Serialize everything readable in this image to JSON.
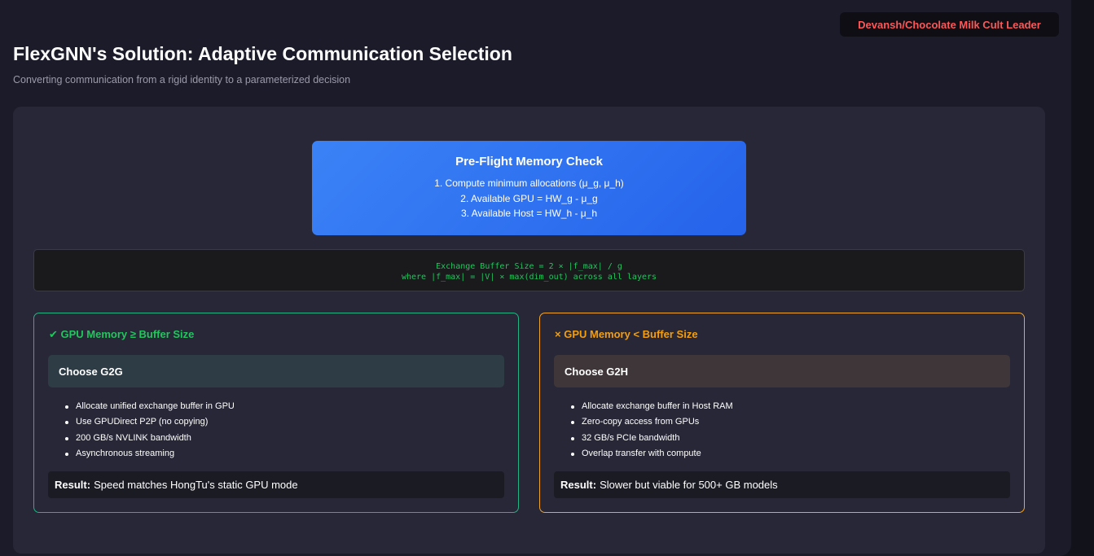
{
  "badge": "Devansh/Chocolate Milk Cult Leader",
  "header": {
    "title": "FlexGNN's Solution: Adaptive Communication Selection",
    "subtitle": "Converting communication from a rigid identity to a parameterized decision"
  },
  "preflight": {
    "title": "Pre-Flight Memory Check",
    "steps": [
      "1. Compute minimum allocations (μ_g, μ_h)",
      "2. Available GPU = HW_g - μ_g",
      "3. Available Host = HW_h - μ_h"
    ]
  },
  "formula": {
    "line1": "Exchange Buffer Size = 2 × |f_max| / g",
    "line2": "where |f_max| = |V| × max(dim_out) across all layers"
  },
  "cards": [
    {
      "condition": "✔ GPU Memory ≥ Buffer Size",
      "choice": "Choose G2G",
      "bullets": [
        "Allocate unified exchange buffer in GPU",
        "Use GPUDirect P2P (no copying)",
        "200 GB/s NVLINK bandwidth",
        "Asynchronous streaming"
      ],
      "result_label": "Result:",
      "result_text": "Speed matches HongTu's static GPU mode"
    },
    {
      "condition": "× GPU Memory < Buffer Size",
      "choice": "Choose G2H",
      "bullets": [
        "Allocate exchange buffer in Host RAM",
        "Zero-copy access from GPUs",
        "32 GB/s PCIe bandwidth",
        "Overlap transfer with compute"
      ],
      "result_label": "Result:",
      "result_text": "Slower but viable for 500+ GB models"
    }
  ],
  "colors": {
    "success": "#22c55e",
    "warning": "#f59e0b",
    "accent_blue": "#3b82f6",
    "badge_text": "#ff5757"
  }
}
